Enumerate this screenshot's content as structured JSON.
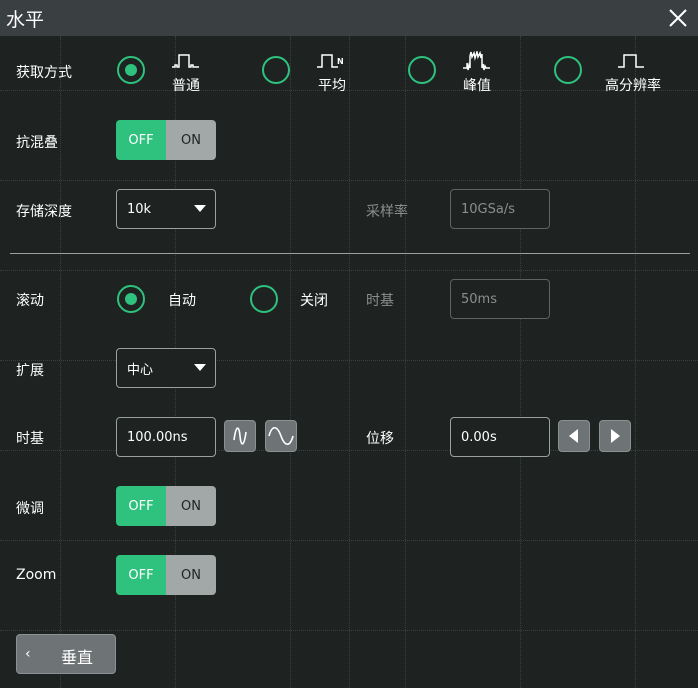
{
  "window": {
    "title": "水平",
    "close_icon": "close-icon"
  },
  "acquisition": {
    "label": "获取方式",
    "selected": "普通",
    "options": [
      {
        "label": "普通",
        "icon": "normal-waveform-icon"
      },
      {
        "label": "平均",
        "icon": "average-waveform-icon"
      },
      {
        "label": "峰值",
        "icon": "peak-waveform-icon"
      },
      {
        "label": "高分辨率",
        "icon": "high-resolution-waveform-icon"
      }
    ]
  },
  "anti_alias": {
    "label": "抗混叠",
    "off_label": "OFF",
    "on_label": "ON",
    "state": "OFF"
  },
  "memory_depth": {
    "label": "存储深度",
    "value": "10k"
  },
  "sample_rate": {
    "label": "采样率",
    "value": "10GSa/s"
  },
  "roll": {
    "label": "滚动",
    "selected": "自动",
    "options": [
      {
        "label": "自动"
      },
      {
        "label": "关闭"
      }
    ]
  },
  "roll_timebase": {
    "label": "时基",
    "value": "50ms"
  },
  "expand": {
    "label": "扩展",
    "value": "中心"
  },
  "timebase": {
    "label": "时基",
    "value": "100.00ns",
    "decrease_icon": "timebase-decrease-icon",
    "increase_icon": "timebase-increase-icon"
  },
  "offset": {
    "label": "位移",
    "value": "0.00s",
    "left_icon": "move-left-icon",
    "right_icon": "move-right-icon"
  },
  "fine": {
    "label": "微调",
    "off_label": "OFF",
    "on_label": "ON",
    "state": "OFF"
  },
  "zoom": {
    "label": "Zoom",
    "off_label": "OFF",
    "on_label": "ON",
    "state": "OFF"
  },
  "back_button": {
    "label": "垂直"
  },
  "colors": {
    "accent": "#2ec27e",
    "background": "#1e2322",
    "titlebar": "#3a3f41",
    "button": "#6e7475",
    "toggle_off_side": "#a2a7a8"
  }
}
